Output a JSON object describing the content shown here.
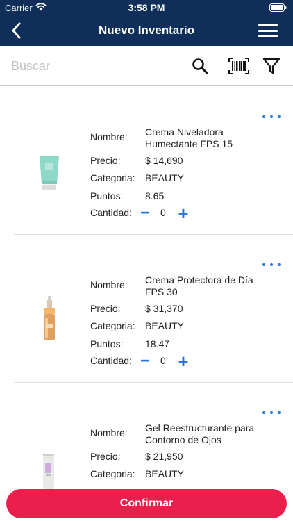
{
  "status_bar": {
    "carrier": "Carrier",
    "time": "3:58 PM"
  },
  "nav": {
    "title": "Nuevo Inventario",
    "back_icon": "chevron-left-icon",
    "menu_icon": "hamburger-menu-icon"
  },
  "search": {
    "placeholder": "Buscar",
    "value": ""
  },
  "toolbar": {
    "search_icon": "search-icon",
    "barcode_icon": "barcode-scan-icon",
    "filter_icon": "filter-icon"
  },
  "labels": {
    "name": "Nombre:",
    "price": "Precio:",
    "category": "Categoria:",
    "points": "Puntos:",
    "quantity": "Cantidad:",
    "minus": "−",
    "plus": "+"
  },
  "products": [
    {
      "name": "Crema Niveladora Humectante FPS 15",
      "price": "$ 14,690",
      "category": "BEAUTY",
      "points": "8.65",
      "quantity": "0",
      "image_color": "#8ed8c8"
    },
    {
      "name": "Crema Protectora de Día FPS 30",
      "price": "$ 31,370",
      "category": "BEAUTY",
      "points": "18.47",
      "quantity": "0",
      "image_color": "#e0a060"
    },
    {
      "name": "Gel Reestructurante para Contorno de Ojos",
      "price": "$ 21,950",
      "category": "BEAUTY",
      "points": "",
      "quantity": "",
      "image_color": "#e9e9e9"
    }
  ],
  "confirm_label": "Confirmar",
  "colors": {
    "navy": "#0f2f5a",
    "accent_blue": "#1f74d6",
    "confirm_red": "#ea1f4b"
  }
}
